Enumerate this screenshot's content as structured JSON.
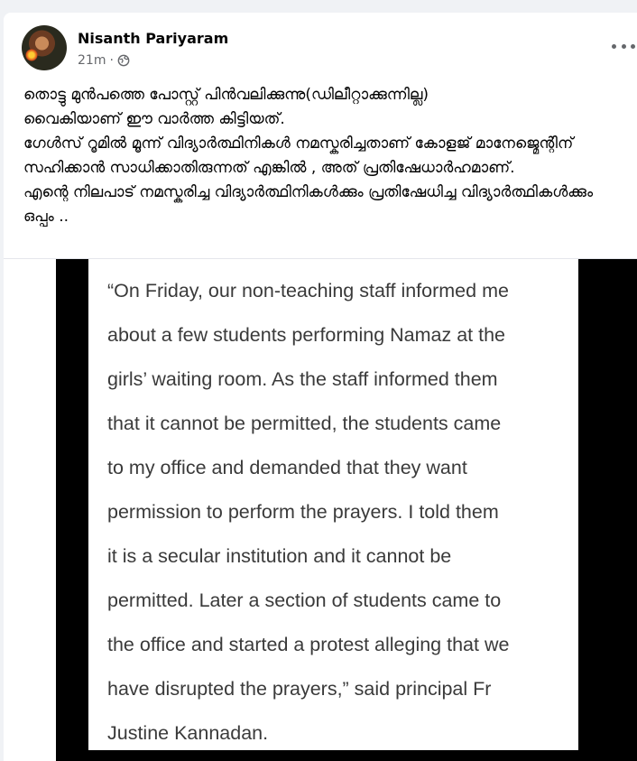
{
  "post": {
    "author": "Nisanth Pariyaram",
    "time": "21m",
    "separator": "·",
    "privacy_icon": "globe-icon",
    "more_icon": "more-options-icon",
    "text": "തൊട്ടു മുൻപത്തെ പോസ്റ്റ് പിൻവലിക്കുന്നു(ഡിലീറ്റാക്കുന്നില്ല)\nവൈകിയാണ് ഈ വാർത്ത കിട്ടിയത്.\nഗേൾസ് റൂമിൽ മൂന്ന് വിദ്യാർത്ഥിനികൾ നമസ്കരിച്ചതാണ് കോളജ് മാനേജ്മെന്റിന് സഹിക്കാൻ സാധിക്കാതിരുന്നത് എങ്കിൽ , അത് പ്രതിഷേധാർഹമാണ്.\nഎന്റെ നിലപാട് നമസ്കരിച്ച വിദ്യാർത്ഥിനികൾക്കും പ്രതിഷേധിച്ച വിദ്യാർത്ഥികൾക്കും ഒപ്പം .."
  },
  "image": {
    "quote": "“On Friday, our non-teaching staff informed me\nabout a few students performing Namaz at the\ngirls’ waiting room. As the staff informed them\nthat it cannot be permitted, the students came\nto my office and demanded that they want\npermission to perform the prayers. I told them\nit is a secular institution and it cannot be\npermitted. Later a section of students came to\nthe office and started a protest alleging that we\nhave disrupted the prayers,” said principal Fr\nJustine Kannadan."
  }
}
